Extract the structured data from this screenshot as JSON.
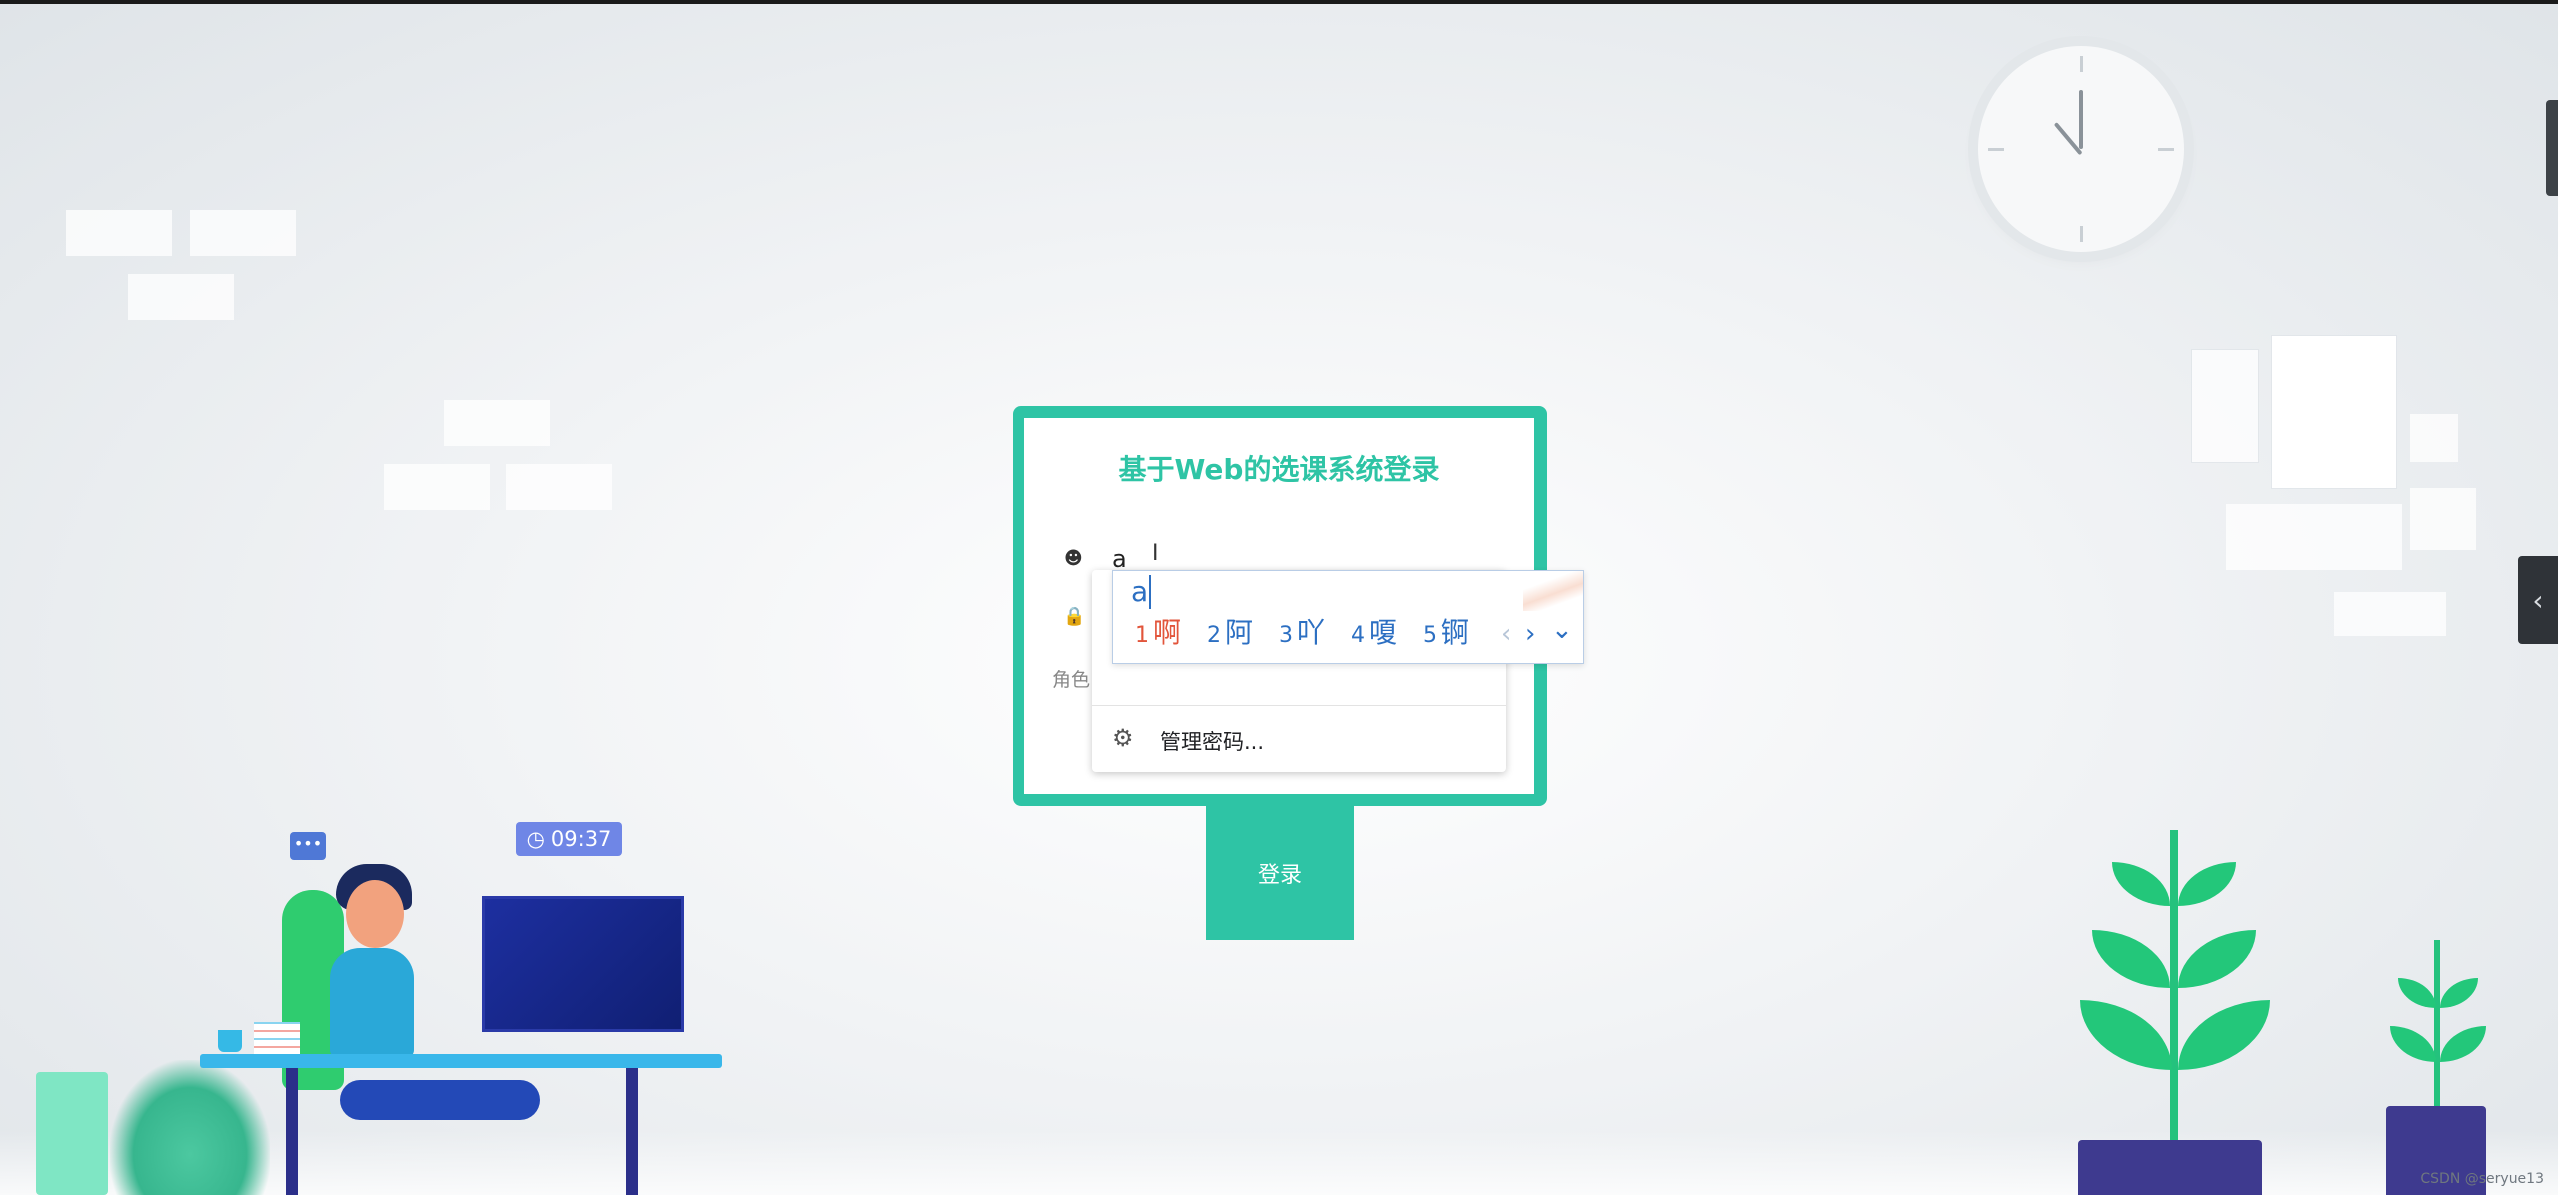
{
  "login": {
    "title": "基于Web的选课系统登录",
    "username_value": "a",
    "password_dots": "•••",
    "role_label": "角色",
    "submit_label": "登录"
  },
  "autofill": {
    "manage_label": "管理密码..."
  },
  "ime": {
    "composition": "a",
    "candidates": [
      {
        "num": "1",
        "text": "啊"
      },
      {
        "num": "2",
        "text": "阿"
      },
      {
        "num": "3",
        "text": "吖"
      },
      {
        "num": "4",
        "text": "嗄"
      },
      {
        "num": "5",
        "text": "锕"
      }
    ],
    "prev": "‹",
    "next": "›",
    "expand": "⌄"
  },
  "illustration": {
    "time": "09:37",
    "chat": "•••"
  },
  "side_panel": {
    "toggle_glyph": "‹"
  },
  "watermark": "CSDN @seryue13",
  "colors": {
    "accent": "#2ec4a5",
    "ime_text": "#2c6fc2",
    "ime_active": "#e2553b"
  },
  "icons": {
    "username": "user-icon",
    "password": "lock-icon",
    "manage": "gear-icon",
    "clock": "clock-icon"
  }
}
